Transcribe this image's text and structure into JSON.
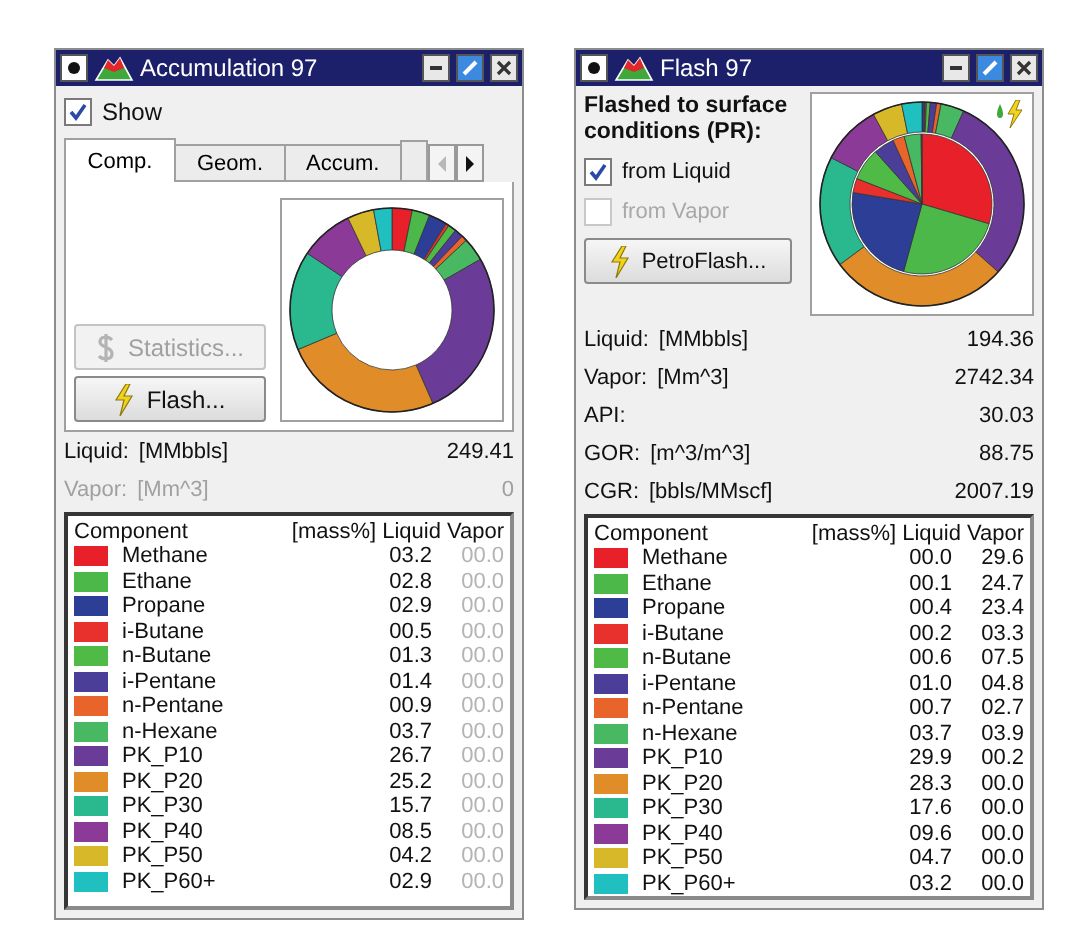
{
  "accumulation_window": {
    "title": "Accumulation 97",
    "show": {
      "label": "Show",
      "checked": true
    },
    "tabs": [
      {
        "label": "Comp.",
        "selected": true
      },
      {
        "label": "Geom.",
        "selected": false
      },
      {
        "label": "Accum.",
        "selected": false
      }
    ],
    "buttons": [
      {
        "label": "Statistics...",
        "kind": "dollar",
        "disabled": true
      },
      {
        "label": "Flash...",
        "kind": "lightning",
        "disabled": false
      }
    ],
    "readings": [
      {
        "label": "Liquid:",
        "unit": "[MMbbls]",
        "value": "249.41",
        "disabled": false
      },
      {
        "label": "Vapor:",
        "unit": "[Mm^3]",
        "value": "0",
        "disabled": true
      }
    ],
    "table": {
      "columns": [
        "Component",
        "[mass%]",
        "Liquid",
        "Vapor"
      ],
      "vapor_disabled": true,
      "rows": [
        {
          "name": "Methane",
          "color": "#e8202a",
          "liquid": "03.2",
          "vapor": "00.0"
        },
        {
          "name": "Ethane",
          "color": "#4cb84a",
          "liquid": "02.8",
          "vapor": "00.0"
        },
        {
          "name": "Propane",
          "color": "#2c3e96",
          "liquid": "02.9",
          "vapor": "00.0"
        },
        {
          "name": "i-Butane",
          "color": "#e8302c",
          "liquid": "00.5",
          "vapor": "00.0"
        },
        {
          "name": "n-Butane",
          "color": "#4fba46",
          "liquid": "01.3",
          "vapor": "00.0"
        },
        {
          "name": "i-Pentane",
          "color": "#4a3e98",
          "liquid": "01.4",
          "vapor": "00.0"
        },
        {
          "name": "n-Pentane",
          "color": "#e8642a",
          "liquid": "00.9",
          "vapor": "00.0"
        },
        {
          "name": "n-Hexane",
          "color": "#48b862",
          "liquid": "03.7",
          "vapor": "00.0"
        },
        {
          "name": "PK_P10",
          "color": "#6a3c98",
          "liquid": "26.7",
          "vapor": "00.0"
        },
        {
          "name": "PK_P20",
          "color": "#e08c28",
          "liquid": "25.2",
          "vapor": "00.0"
        },
        {
          "name": "PK_P30",
          "color": "#2ab88e",
          "liquid": "15.7",
          "vapor": "00.0"
        },
        {
          "name": "PK_P40",
          "color": "#8c3a98",
          "liquid": "08.5",
          "vapor": "00.0"
        },
        {
          "name": "PK_P50",
          "color": "#d6b828",
          "liquid": "04.2",
          "vapor": "00.0"
        },
        {
          "name": "PK_P60+",
          "color": "#20c0c0",
          "liquid": "02.9",
          "vapor": "00.0"
        }
      ]
    }
  },
  "flash_window": {
    "title": "Flash 97",
    "heading": "Flashed to surface conditions (PR):",
    "options": [
      {
        "label": "from Liquid",
        "checked": true,
        "disabled": false
      },
      {
        "label": "from Vapor",
        "checked": false,
        "disabled": true
      }
    ],
    "button": {
      "label": "PetroFlash...",
      "kind": "lightning",
      "disabled": false
    },
    "readings": [
      {
        "label": "Liquid:",
        "unit": "[MMbbls]",
        "value": "194.36",
        "disabled": false
      },
      {
        "label": "Vapor:",
        "unit": "[Mm^3]",
        "value": "2742.34",
        "disabled": false
      },
      {
        "label": "API:",
        "value": "30.03",
        "disabled": false
      },
      {
        "label": "GOR:",
        "unit": "[m^3/m^3]",
        "value": "88.75",
        "disabled": false
      },
      {
        "label": "CGR:",
        "unit": "[bbls/MMscf]",
        "value": "2007.19",
        "disabled": false
      }
    ],
    "table": {
      "columns": [
        "Component",
        "[mass%]",
        "Liquid",
        "Vapor"
      ],
      "vapor_disabled": false,
      "rows": [
        {
          "name": "Methane",
          "color": "#e8202a",
          "liquid": "00.0",
          "vapor": "29.6"
        },
        {
          "name": "Ethane",
          "color": "#4cb84a",
          "liquid": "00.1",
          "vapor": "24.7"
        },
        {
          "name": "Propane",
          "color": "#2c3e96",
          "liquid": "00.4",
          "vapor": "23.4"
        },
        {
          "name": "i-Butane",
          "color": "#e8302c",
          "liquid": "00.2",
          "vapor": "03.3"
        },
        {
          "name": "n-Butane",
          "color": "#4fba46",
          "liquid": "00.6",
          "vapor": "07.5"
        },
        {
          "name": "i-Pentane",
          "color": "#4a3e98",
          "liquid": "01.0",
          "vapor": "04.8"
        },
        {
          "name": "n-Pentane",
          "color": "#e8642a",
          "liquid": "00.7",
          "vapor": "02.7"
        },
        {
          "name": "n-Hexane",
          "color": "#48b862",
          "liquid": "03.7",
          "vapor": "03.9"
        },
        {
          "name": "PK_P10",
          "color": "#6a3c98",
          "liquid": "29.9",
          "vapor": "00.2"
        },
        {
          "name": "PK_P20",
          "color": "#e08c28",
          "liquid": "28.3",
          "vapor": "00.0"
        },
        {
          "name": "PK_P30",
          "color": "#2ab88e",
          "liquid": "17.6",
          "vapor": "00.0"
        },
        {
          "name": "PK_P40",
          "color": "#8c3a98",
          "liquid": "09.6",
          "vapor": "00.0"
        },
        {
          "name": "PK_P50",
          "color": "#d6b828",
          "liquid": "04.7",
          "vapor": "00.0"
        },
        {
          "name": "PK_P60+",
          "color": "#20c0c0",
          "liquid": "03.2",
          "vapor": "00.0"
        }
      ]
    }
  }
}
